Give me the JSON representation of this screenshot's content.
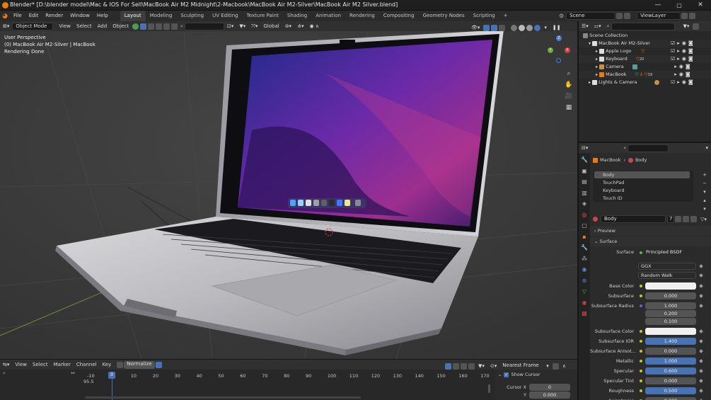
{
  "titlebar": {
    "title": "Blender* [D:\\blender model\\Mac & IOS For Sell\\MacBook Air M2 Midnight\\2-Macbook\\MacBook Air M2-Silver\\MacBook Air M2 Silver.blend]",
    "min": "—",
    "max": "▢",
    "close": "✕"
  },
  "menubar": {
    "items": [
      "File",
      "Edit",
      "Render",
      "Window",
      "Help"
    ],
    "workspaces": [
      "Layout",
      "Modeling",
      "Sculpting",
      "UV Editing",
      "Texture Paint",
      "Shading",
      "Animation",
      "Rendering",
      "Compositing",
      "Geometry Nodes",
      "Scripting"
    ],
    "add_tab": "+",
    "scene": "Scene",
    "view_layer": "ViewLayer"
  },
  "viewport_header": {
    "mode": "Object Mode",
    "menus": [
      "View",
      "Select",
      "Add",
      "Object"
    ],
    "transform": "Global"
  },
  "viewport": {
    "line1": "User Perspective",
    "line2": "(0) MacBook Air M2-Silver | MacBook",
    "line3": "Rendering Done",
    "gizmo_x": "X",
    "gizmo_y": "Y",
    "gizmo_z": "Z"
  },
  "outliner": {
    "rows": [
      {
        "label": "Scene Collection"
      },
      {
        "label": "MacBook Air M2-Silver"
      },
      {
        "label": "Apple Logo"
      },
      {
        "label": "Keyboard"
      },
      {
        "label": "Camera"
      },
      {
        "label": "MacBook"
      },
      {
        "label": "Lights & Camera"
      }
    ],
    "keyboard_badge": "20",
    "macbook_badge": "19"
  },
  "properties": {
    "breadcrumb_obj": "MacBook",
    "breadcrumb_mat": "Body",
    "materials": [
      "Body",
      "TouchPad",
      "Keyboard",
      "Touch ID"
    ],
    "material_name": "Body",
    "users": "7",
    "preview": "Preview",
    "surface_section": "Surface",
    "surface_label": "Surface",
    "surface_value": "Principled BSDF",
    "distribution": "GGX",
    "subsurface_method": "Random Walk",
    "fields": [
      {
        "label": "Base Color",
        "value": "",
        "kind": "white"
      },
      {
        "label": "Subsurface",
        "value": "0.000",
        "kind": "gray"
      },
      {
        "label": "Subsurface Radius",
        "value": "1.000",
        "kind": "gray"
      },
      {
        "label": "",
        "value": "0.200",
        "kind": "gray"
      },
      {
        "label": "",
        "value": "0.100",
        "kind": "gray"
      },
      {
        "label": "Subsurface Color",
        "value": "",
        "kind": "white"
      },
      {
        "label": "Subsurface IOR",
        "value": "1.400",
        "kind": "blue"
      },
      {
        "label": "Subsurface Anisot...",
        "value": "0.000",
        "kind": "gray"
      },
      {
        "label": "Metallic",
        "value": "1.000",
        "kind": "blue"
      },
      {
        "label": "Specular",
        "value": "0.600",
        "kind": "blue"
      },
      {
        "label": "Specular Tint",
        "value": "0.000",
        "kind": "gray"
      },
      {
        "label": "Roughness",
        "value": "0.500",
        "kind": "blue"
      },
      {
        "label": "Anisotropic",
        "value": "0.000",
        "kind": "gray"
      }
    ]
  },
  "timeline": {
    "menus": [
      "View",
      "Select",
      "Marker",
      "Channel",
      "Key"
    ],
    "normalize": "Normalize",
    "frame_mode": "Nearest Frame",
    "ticks": [
      "-10",
      "0",
      "10",
      "20",
      "30",
      "40",
      "50",
      "60",
      "70",
      "80",
      "90",
      "100",
      "110",
      "120",
      "130",
      "140",
      "150",
      "160",
      "170"
    ],
    "value_95": "95.5",
    "show_cursor": "Show Cursor",
    "cursor_x_label": "Cursor X",
    "cursor_x": "0",
    "cursor_y_label": "Y",
    "cursor_y": "0.000"
  },
  "colors": {
    "accent": "#4772b3",
    "header": "#303030",
    "viewport": "#3d3d3d"
  }
}
